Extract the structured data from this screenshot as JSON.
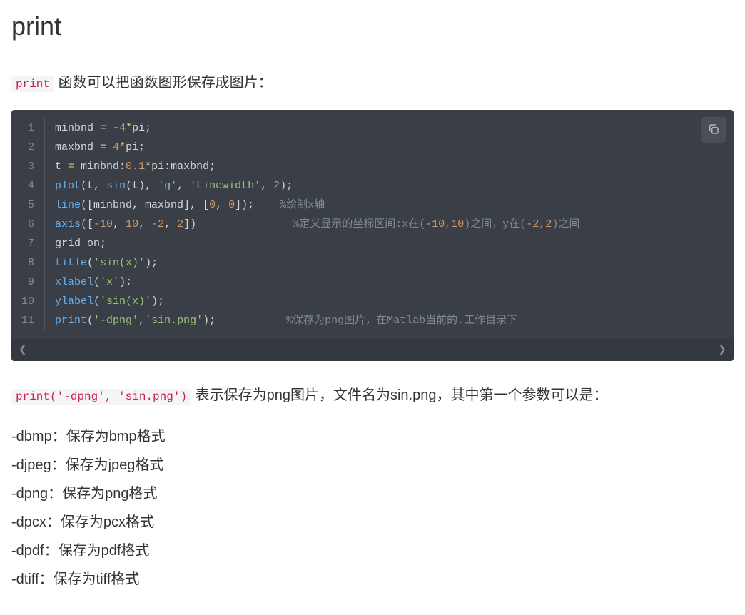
{
  "heading": "print",
  "intro_code": "print",
  "intro_text": " 函数可以把函数图形保存成图片：",
  "code": {
    "lines": [
      [
        {
          "t": "id",
          "v": "minbnd "
        },
        {
          "t": "op",
          "v": "="
        },
        {
          "t": "id",
          "v": " "
        },
        {
          "t": "op",
          "v": "-"
        },
        {
          "t": "num",
          "v": "4"
        },
        {
          "t": "op",
          "v": "*"
        },
        {
          "t": "id",
          "v": "pi;"
        }
      ],
      [
        {
          "t": "id",
          "v": "maxbnd "
        },
        {
          "t": "op",
          "v": "="
        },
        {
          "t": "id",
          "v": " "
        },
        {
          "t": "num",
          "v": "4"
        },
        {
          "t": "op",
          "v": "*"
        },
        {
          "t": "id",
          "v": "pi;"
        }
      ],
      [
        {
          "t": "id",
          "v": "t "
        },
        {
          "t": "op",
          "v": "="
        },
        {
          "t": "id",
          "v": " minbnd:"
        },
        {
          "t": "num",
          "v": "0.1"
        },
        {
          "t": "op",
          "v": "*"
        },
        {
          "t": "id",
          "v": "pi:maxbnd;"
        }
      ],
      [
        {
          "t": "fn",
          "v": "plot"
        },
        {
          "t": "id",
          "v": "(t, "
        },
        {
          "t": "fn",
          "v": "sin"
        },
        {
          "t": "id",
          "v": "(t), "
        },
        {
          "t": "str",
          "v": "'g'"
        },
        {
          "t": "id",
          "v": ", "
        },
        {
          "t": "str",
          "v": "'Linewidth'"
        },
        {
          "t": "id",
          "v": ", "
        },
        {
          "t": "num",
          "v": "2"
        },
        {
          "t": "id",
          "v": ");"
        }
      ],
      [
        {
          "t": "fn",
          "v": "line"
        },
        {
          "t": "id",
          "v": "([minbnd, maxbnd], ["
        },
        {
          "t": "num",
          "v": "0"
        },
        {
          "t": "id",
          "v": ", "
        },
        {
          "t": "num",
          "v": "0"
        },
        {
          "t": "id",
          "v": "]);    "
        },
        {
          "t": "com",
          "v": "%绘制x轴"
        }
      ],
      [
        {
          "t": "fn",
          "v": "axis"
        },
        {
          "t": "id",
          "v": "(["
        },
        {
          "t": "num",
          "v": "-10"
        },
        {
          "t": "id",
          "v": ", "
        },
        {
          "t": "num",
          "v": "10"
        },
        {
          "t": "id",
          "v": ", "
        },
        {
          "t": "num",
          "v": "-2"
        },
        {
          "t": "id",
          "v": ", "
        },
        {
          "t": "num",
          "v": "2"
        },
        {
          "t": "id",
          "v": "])               "
        },
        {
          "t": "com",
          "v": "%定义显示的坐标区间:x在("
        },
        {
          "t": "num",
          "v": "-10"
        },
        {
          "t": "com",
          "v": ","
        },
        {
          "t": "num",
          "v": "10"
        },
        {
          "t": "com",
          "v": ")之间，y在("
        },
        {
          "t": "num",
          "v": "-2"
        },
        {
          "t": "com",
          "v": ","
        },
        {
          "t": "num",
          "v": "2"
        },
        {
          "t": "com",
          "v": ")之间"
        }
      ],
      [
        {
          "t": "id",
          "v": "grid on;"
        }
      ],
      [
        {
          "t": "fn",
          "v": "title"
        },
        {
          "t": "id",
          "v": "("
        },
        {
          "t": "str",
          "v": "'sin(x)'"
        },
        {
          "t": "id",
          "v": ");"
        }
      ],
      [
        {
          "t": "fn",
          "v": "xlabel"
        },
        {
          "t": "id",
          "v": "("
        },
        {
          "t": "str",
          "v": "'x'"
        },
        {
          "t": "id",
          "v": ");"
        }
      ],
      [
        {
          "t": "fn",
          "v": "ylabel"
        },
        {
          "t": "id",
          "v": "("
        },
        {
          "t": "str",
          "v": "'sin(x)'"
        },
        {
          "t": "id",
          "v": ");"
        }
      ],
      [
        {
          "t": "fn",
          "v": "print"
        },
        {
          "t": "id",
          "v": "("
        },
        {
          "t": "str",
          "v": "'-dpng'"
        },
        {
          "t": "id",
          "v": ","
        },
        {
          "t": "str",
          "v": "'sin.png'"
        },
        {
          "t": "id",
          "v": ");           "
        },
        {
          "t": "com",
          "v": "%保存为png图片，在Matlab当前的.工作目录下"
        }
      ]
    ]
  },
  "explain_code": "print('-dpng', 'sin.png')",
  "explain_text": " 表示保存为png图片，文件名为sin.png，其中第一个参数可以是：",
  "formats": [
    "-dbmp：保存为bmp格式",
    "-djpeg：保存为jpeg格式",
    "-dpng：保存为png格式",
    "-dpcx：保存为pcx格式",
    "-dpdf：保存为pdf格式",
    "-dtiff：保存为tiff格式"
  ],
  "scroll": {
    "left": "❮",
    "right": "❯"
  }
}
